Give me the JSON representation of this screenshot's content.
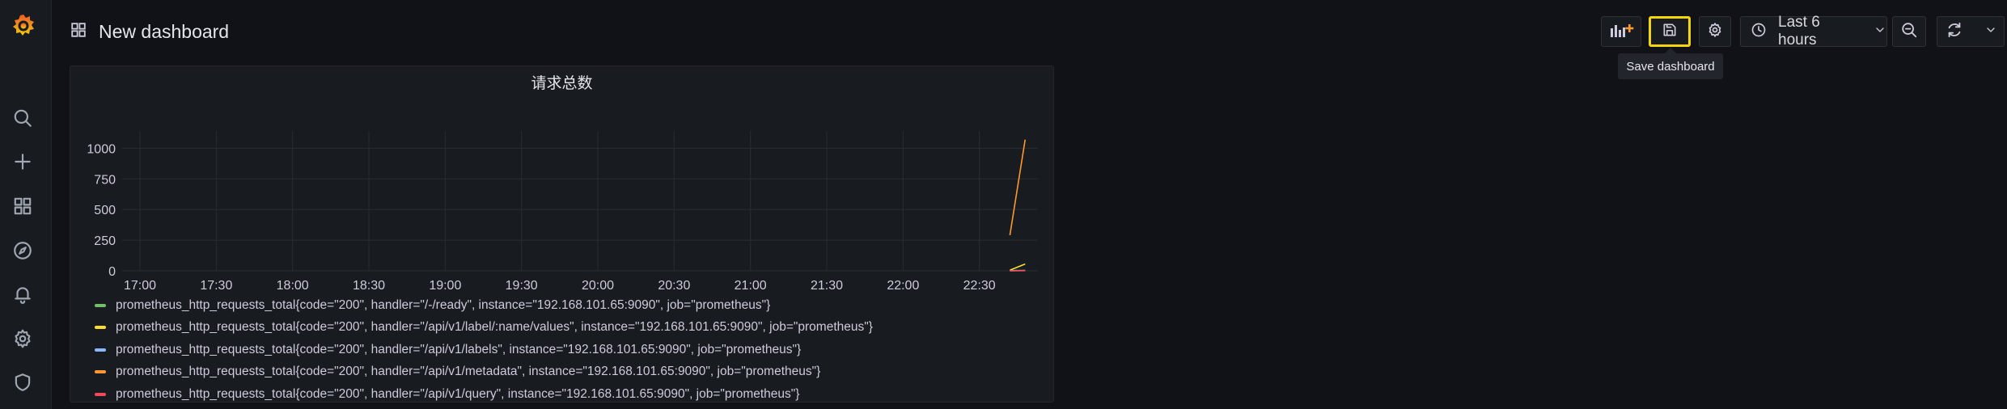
{
  "app": {
    "logo_icon": "grafana-logo-icon"
  },
  "sidebar": {
    "items": [
      {
        "name": "search",
        "icon": "search-icon"
      },
      {
        "name": "create",
        "icon": "plus-icon"
      },
      {
        "name": "dashboards",
        "icon": "apps-icon"
      },
      {
        "name": "explore",
        "icon": "compass-icon"
      },
      {
        "name": "alerting",
        "icon": "bell-icon"
      },
      {
        "name": "configuration",
        "icon": "gear-icon"
      },
      {
        "name": "server-admin",
        "icon": "shield-icon"
      }
    ]
  },
  "header": {
    "title": "New dashboard",
    "time_range": "Last 6 hours",
    "tooltip": "Save dashboard"
  },
  "panel": {
    "title": "请求总数"
  },
  "chart_data": {
    "type": "line",
    "title": "请求总数",
    "xlabel": "",
    "ylabel": "",
    "x_ticks": [
      "17:00",
      "17:30",
      "18:00",
      "18:30",
      "19:00",
      "19:30",
      "20:00",
      "20:30",
      "21:00",
      "21:30",
      "22:00",
      "22:30"
    ],
    "y_ticks": [
      0,
      250,
      500,
      750,
      1000
    ],
    "ylim": [
      0,
      1075
    ],
    "x_range": [
      "16:53",
      "22:53"
    ],
    "grid": true,
    "legend_position": "bottom",
    "series": [
      {
        "name": "prometheus_http_requests_total{code=\"200\", handler=\"/-/ready\", instance=\"192.168.101.65:9090\", job=\"prometheus\"}",
        "color": "#73bf69",
        "x": [
          "22:42",
          "22:48"
        ],
        "y": [
          2,
          3
        ]
      },
      {
        "name": "prometheus_http_requests_total{code=\"200\", handler=\"/api/v1/label/:name/values\", instance=\"192.168.101.65:9090\", job=\"prometheus\"}",
        "color": "#fade2a",
        "x": [
          "22:42",
          "22:48"
        ],
        "y": [
          5,
          55
        ]
      },
      {
        "name": "prometheus_http_requests_total{code=\"200\", handler=\"/api/v1/labels\", instance=\"192.168.101.65:9090\", job=\"prometheus\"}",
        "color": "#8ab8ff",
        "x": [
          "22:42",
          "22:48"
        ],
        "y": [
          0,
          2
        ]
      },
      {
        "name": "prometheus_http_requests_total{code=\"200\", handler=\"/api/v1/metadata\", instance=\"192.168.101.65:9090\", job=\"prometheus\"}",
        "color": "#ff9830",
        "x": [
          "22:42",
          "22:48"
        ],
        "y": [
          290,
          1070
        ]
      },
      {
        "name": "prometheus_http_requests_total{code=\"200\", handler=\"/api/v1/query\", instance=\"192.168.101.65:9090\", job=\"prometheus\"}",
        "color": "#f2495c",
        "x": [
          "22:42",
          "22:48"
        ],
        "y": [
          0,
          1
        ]
      }
    ]
  }
}
